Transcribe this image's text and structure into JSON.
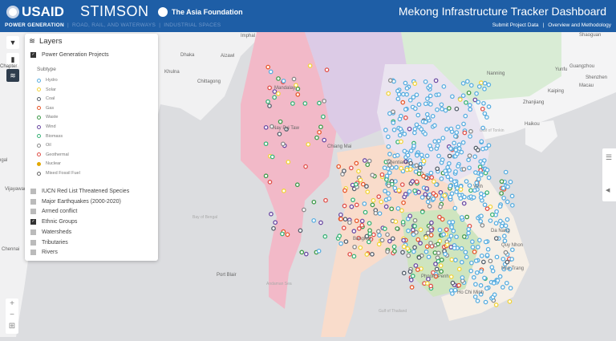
{
  "header": {
    "logos": [
      "USAID",
      "STIMSON",
      "The Asia Foundation"
    ],
    "title": "Mekong Infrastructure Tracker Dashboard",
    "nav": [
      {
        "label": "POWER GENERATION",
        "active": true
      },
      {
        "label": "ROAD, RAIL, AND WATERWAYS",
        "active": false
      },
      {
        "label": "INDUSTRIAL SPACES",
        "active": false
      }
    ],
    "links": [
      "Submit Project Data",
      "Overview and Methodology"
    ]
  },
  "toolbar": {
    "filter_icon": "filter-icon",
    "chart_icon": "bar-chart-icon",
    "layers_icon": "layers-icon",
    "chart_tooltip": "Chapter"
  },
  "layers": {
    "title": "Layers",
    "power": {
      "label": "Power Generation Projects",
      "checked": true
    },
    "subtype_label": "Subtype",
    "subtypes": [
      {
        "label": "Hydro",
        "color": "#5aaee0"
      },
      {
        "label": "Solar",
        "color": "#f2d43a"
      },
      {
        "label": "Coal",
        "color": "#555f6b"
      },
      {
        "label": "Gas",
        "color": "#e8572a"
      },
      {
        "label": "Waste",
        "color": "#3f9a4a"
      },
      {
        "label": "Wind",
        "color": "#6b4aa3"
      },
      {
        "label": "Biomass",
        "color": "#39b377"
      },
      {
        "label": "Oil",
        "color": "#8a8a8a"
      },
      {
        "label": "Geothermal",
        "color": "#e0504a"
      },
      {
        "label": "Nuclear",
        "color": "#e2a800"
      },
      {
        "label": "Mixed Fossil Fuel",
        "color": "#666666"
      }
    ],
    "other": [
      {
        "label": "IUCN Red List Threatened Species",
        "checked": false
      },
      {
        "label": "Major Earthquakes (2000-2020)",
        "checked": false
      },
      {
        "label": "Armed conflict",
        "checked": false
      },
      {
        "label": "Ethnic Groups",
        "checked": true
      },
      {
        "label": "Watersheds",
        "checked": false
      },
      {
        "label": "Tributaries",
        "checked": false
      },
      {
        "label": "Rivers",
        "checked": false
      }
    ]
  },
  "zoom": {
    "in": "+",
    "out": "−",
    "extent": "⊞"
  },
  "map": {
    "labels": {
      "imphal": "Imphal",
      "dhaka": "Dhaka",
      "aizawl": "Aizawl",
      "khulna": "Khulna",
      "chittagong": "Chittagong",
      "mandalay": "Mandalay",
      "naypyitaw": "Nay Pyi Taw",
      "chiangmai": "Chiang Mai",
      "nanning": "Nanning",
      "shaoguan": "Shaoguan",
      "yunfu": "Yunfu",
      "guangzhou": "Guangzhou",
      "shenzhen": "Shenzhen",
      "macau": "Macau",
      "kaiping": "Kaiping",
      "zhanjiang": "Zhanjiang",
      "haikou": "Haikou",
      "tonkin": "Gulf of Tonkin",
      "vientiane": "Vientiane",
      "vinh": "Vinh",
      "danang": "Da Nang",
      "bengal": "Bay of Bengal",
      "bengal_left": "ngal",
      "vijayawada": "Vijayawada",
      "chennai": "Chennai",
      "portblair": "Port Blair",
      "andaman": "Andaman Sea",
      "bangkok": "Bangkok",
      "thailand_gulf": "Gulf of Thailand",
      "phnompenh": "Phnom Penh",
      "hcmc": "Ho Chi Minh",
      "nhatrang": "Nha Trang",
      "quynhon": "Quy Nhon"
    }
  },
  "right_panel": {
    "list_icon": "list-icon",
    "collapse_icon": "collapse-left-icon"
  }
}
